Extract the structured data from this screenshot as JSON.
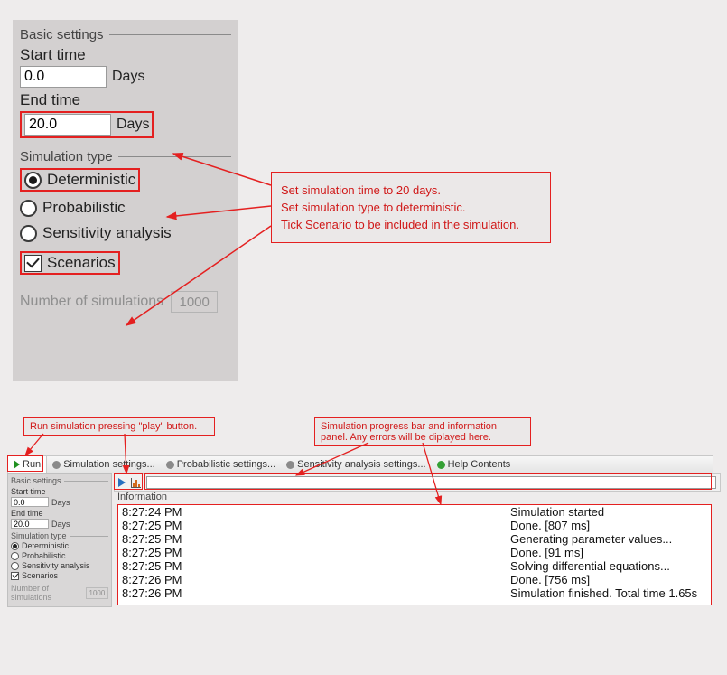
{
  "top_panel": {
    "basic_settings_title": "Basic settings",
    "start_time_label": "Start time",
    "start_time_value": "0.0",
    "start_time_unit": "Days",
    "end_time_label": "End time",
    "end_time_value": "20.0",
    "end_time_unit": "Days",
    "simulation_type_title": "Simulation type",
    "radio_deterministic": "Deterministic",
    "radio_probabilistic": "Probabilistic",
    "radio_sensitivity": "Sensitivity analysis",
    "check_scenarios": "Scenarios",
    "num_sim_label": "Number of simulations",
    "num_sim_value": "1000"
  },
  "annotation_top": {
    "l1": "Set simulation time to 20 days.",
    "l2": "Set simulation type to deterministic.",
    "l3": "Tick Scenario to be included in the simulation."
  },
  "annotation_bottom_left": "Run simulation pressing \"play\" button.",
  "annotation_bottom_right": "Simulation progress bar and information panel. Any errors will be diplayed here.",
  "tabs": {
    "run": "Run",
    "sim_settings": "Simulation settings...",
    "prob_settings": "Probabilistic settings...",
    "sens_settings": "Sensitivity analysis settings...",
    "help": "Help Contents"
  },
  "small_panel": {
    "basic_settings_title": "Basic settings",
    "start_time_label": "Start time",
    "start_time_value": "0.0",
    "start_time_unit": "Days",
    "end_time_label": "End time",
    "end_time_value": "20.0",
    "end_time_unit": "Days",
    "simulation_type_title": "Simulation type",
    "radio_deterministic": "Deterministic",
    "radio_probabilistic": "Probabilistic",
    "radio_sensitivity": "Sensitivity analysis",
    "check_scenarios": "Scenarios",
    "num_sim_label": "Number of simulations",
    "num_sim_value": "1000"
  },
  "info_title": "Information",
  "log": [
    {
      "t": "8:27:24 PM",
      "m": "Simulation started"
    },
    {
      "t": "8:27:25 PM",
      "m": "Done. [807 ms]"
    },
    {
      "t": "8:27:25 PM",
      "m": "Generating parameter values..."
    },
    {
      "t": "8:27:25 PM",
      "m": "Done. [91 ms]"
    },
    {
      "t": "8:27:25 PM",
      "m": "Solving differential equations..."
    },
    {
      "t": "8:27:26 PM",
      "m": "Done. [756 ms]"
    },
    {
      "t": "8:27:26 PM",
      "m": "Simulation finished. Total time 1.65s"
    }
  ]
}
